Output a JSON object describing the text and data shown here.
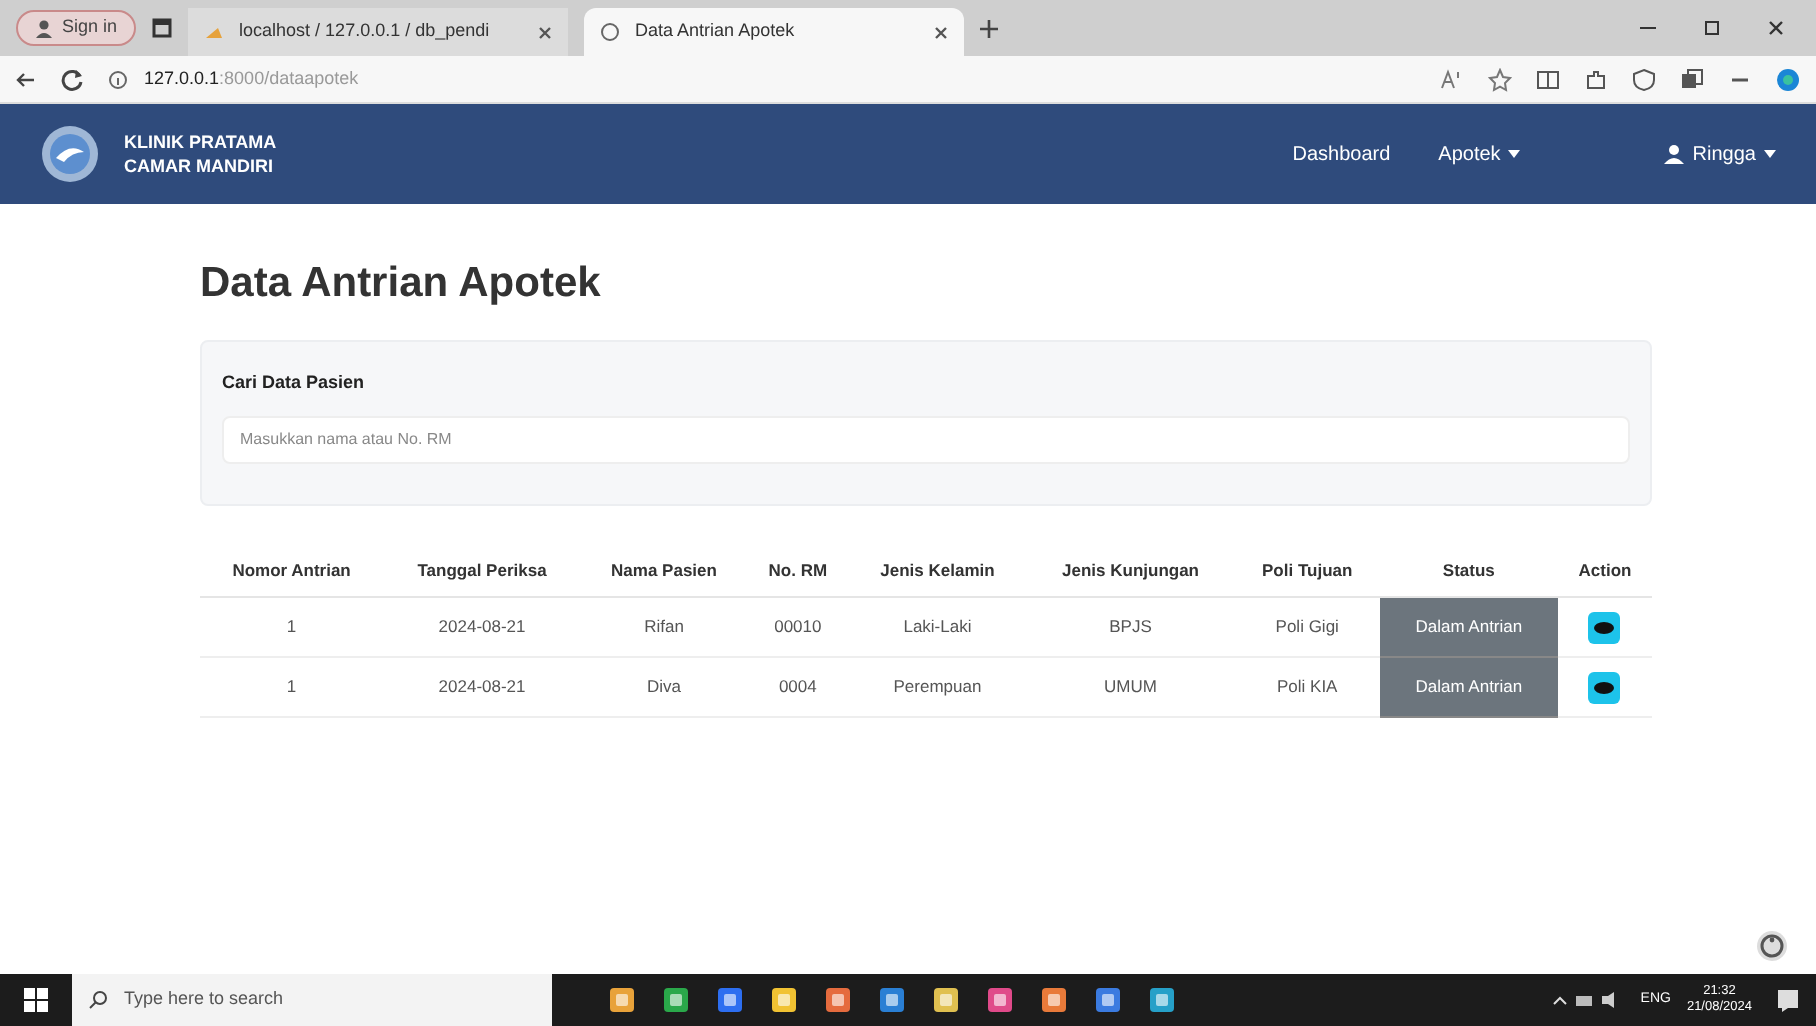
{
  "browser": {
    "profile": "Sign in",
    "tabs": [
      {
        "label": "localhost / 127.0.0.1 / db_pendi",
        "selected": false
      },
      {
        "label": "Data Antrian Apotek",
        "selected": true
      }
    ],
    "url_host": "127.0.0.1",
    "url_rest": ":8000/dataapotek"
  },
  "navbar": {
    "brand": [
      "KLINIK PRATAMA",
      "CAMAR MANDIRI"
    ],
    "links": [
      {
        "label": "Dashboard",
        "dropdown": false
      },
      {
        "label": "Apotek",
        "dropdown": true
      }
    ],
    "user": "Ringga"
  },
  "page": {
    "title": "Data Antrian Apotek",
    "search": {
      "label": "Cari Data Pasien",
      "placeholder": "Masukkan nama atau No. RM"
    },
    "table": {
      "columns": [
        "Nomor Antrian",
        "Tanggal Periksa",
        "Nama Pasien",
        "No. RM",
        "Jenis Kelamin",
        "Jenis Kunjungan",
        "Poli Tujuan",
        "Status",
        "Action"
      ],
      "rows": [
        {
          "cells": [
            "1",
            "2024-08-21",
            "Rifan",
            "00010",
            "Laki-Laki",
            "BPJS",
            "Poli Gigi"
          ],
          "status": "Dalam Antrian"
        },
        {
          "cells": [
            "1",
            "2024-08-21",
            "Diva",
            "0004",
            "Perempuan",
            "UMUM",
            "Poli KIA"
          ],
          "status": "Dalam Antrian"
        }
      ]
    }
  },
  "taskbar": {
    "search_placeholder": "Type here to search",
    "language": "ENG",
    "time": "21:32",
    "date": "21/08/2024"
  }
}
